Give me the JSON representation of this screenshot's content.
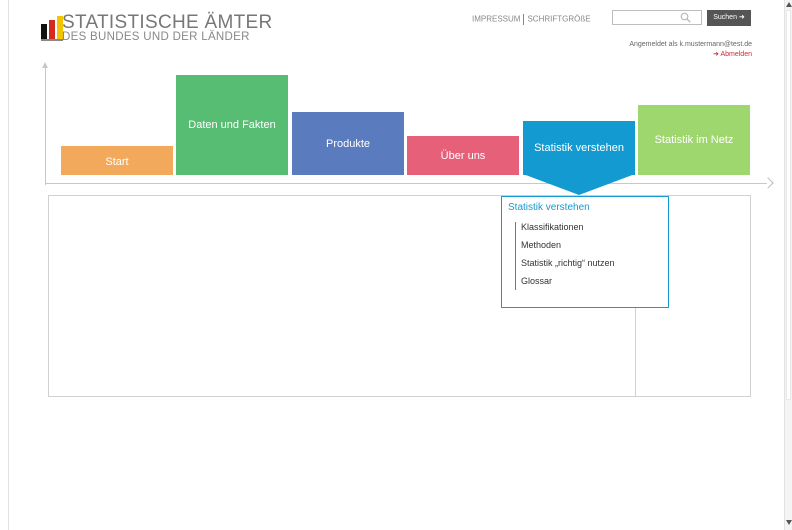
{
  "header": {
    "logo": {
      "title": "STATISTISCHE ÄMTER",
      "subtitle": "DES BUNDES UND DER LÄNDER",
      "bar_colors": [
        "#111111",
        "#d52b1e",
        "#f2c500"
      ]
    },
    "links": {
      "impressum": "IMPRESSUM",
      "schriftgroesse": "SCHRIFTGRÖßE"
    },
    "search": {
      "placeholder": "",
      "button_label": "Suchen ➜"
    },
    "login": {
      "status": "Angemeldet als k.mustermann@test.de",
      "logout": "➜ Abmelden"
    }
  },
  "nav": [
    {
      "label": "Start",
      "color": "#f2a95b"
    },
    {
      "label": "Daten und Fakten",
      "color": "#56bd72"
    },
    {
      "label": "Produkte",
      "color": "#5a7bbd"
    },
    {
      "label": "Über uns",
      "color": "#e76079"
    },
    {
      "label": "Statistik verstehen",
      "color": "#139ad1",
      "active": true
    },
    {
      "label": "Statistik im Netz",
      "color": "#9fd76f"
    }
  ],
  "dropdown": {
    "title": "Statistik verstehen",
    "items": [
      "Klassifikationen",
      "Methoden",
      "Statistik „richtig“ nutzen",
      "Glossar"
    ]
  }
}
